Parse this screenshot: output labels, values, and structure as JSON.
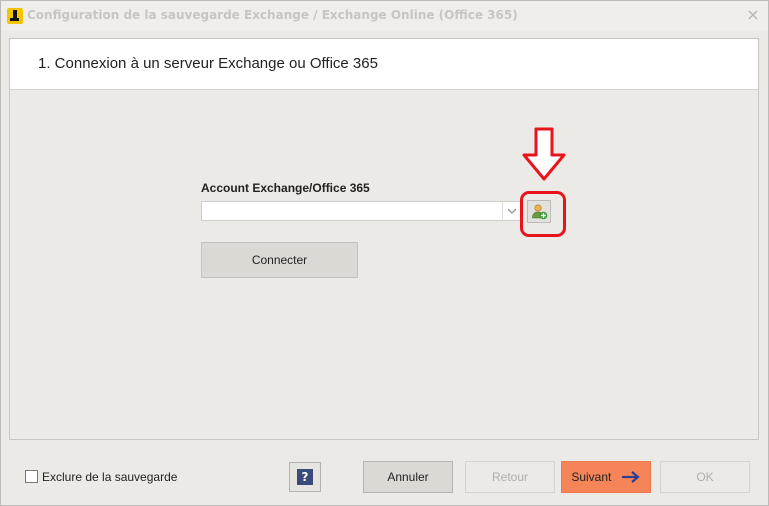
{
  "window": {
    "title": "Configuration de la sauvegarde Exchange / Exchange Online (Office 365)",
    "close_label": "×"
  },
  "step": {
    "title": "1. Connexion à un serveur Exchange ou Office 365"
  },
  "form": {
    "account_label": "Account Exchange/Office 365",
    "account_value": "",
    "connect_label": "Connecter"
  },
  "footer": {
    "exclude_label": "Exclure de la sauvegarde",
    "exclude_checked": false,
    "help_label": "?",
    "cancel_label": "Annuler",
    "back_label": "Retour",
    "next_label": "Suivant",
    "ok_label": "OK"
  },
  "colors": {
    "annotation": "#e8141b",
    "next_button": "#f58559",
    "help_icon": "#3b4a7a"
  },
  "icons": {
    "app": "app-logo-icon",
    "add_account": "add-user-icon",
    "annotation": "down-arrow-annotation",
    "next": "arrow-right-icon"
  }
}
